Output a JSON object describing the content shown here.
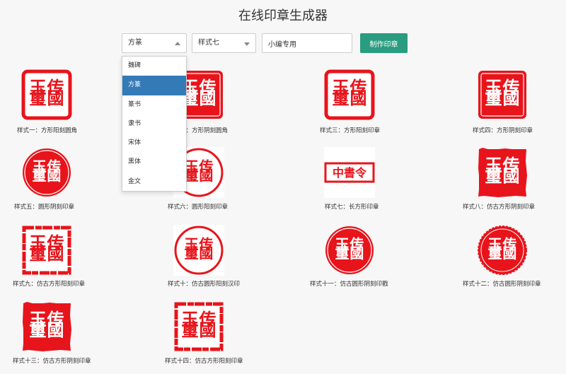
{
  "page": {
    "title": "在线印章生成器"
  },
  "controls": {
    "font_select": {
      "value": "方篆",
      "options": [
        "魏碑",
        "方篆",
        "篆书",
        "隶书",
        "宋体",
        "黑体",
        "金文"
      ],
      "selected_index": 1
    },
    "style_select": {
      "value": "样式七"
    },
    "text_input": {
      "value": "小编专用"
    },
    "make_button": {
      "label": "制作印章"
    }
  },
  "seal_text": {
    "chars": [
      "传",
      "國",
      "玉",
      "璽"
    ],
    "rect_text": "中書令"
  },
  "colors": {
    "seal_red": "#e8141b",
    "button_green": "#2a9d80",
    "selected_blue": "#337ab7"
  },
  "seals": [
    {
      "caption": "样式一：方形阳刻圆角"
    },
    {
      "caption": "样式二：方形阴刻圆角"
    },
    {
      "caption": "样式三：方形阳刻印章"
    },
    {
      "caption": "样式四：方形阴刻印章"
    },
    {
      "caption": "样式五：圆形阴刻印章"
    },
    {
      "caption": "样式六：圆形阳刻印章"
    },
    {
      "caption": "样式七：长方形印章"
    },
    {
      "caption": "样式八：仿古方形阴刻印章"
    },
    {
      "caption": "样式九：仿古方形阳刻印章"
    },
    {
      "caption": "样式十：仿古圆形阳刻汉印"
    },
    {
      "caption": "样式十一：仿古圆形阴刻印戳"
    },
    {
      "caption": "样式十二：仿古圆形阴刻印章"
    },
    {
      "caption": "样式十三：仿古方形阴刻印章"
    },
    {
      "caption": "样式十四：仿古方形阳刻印章"
    }
  ]
}
